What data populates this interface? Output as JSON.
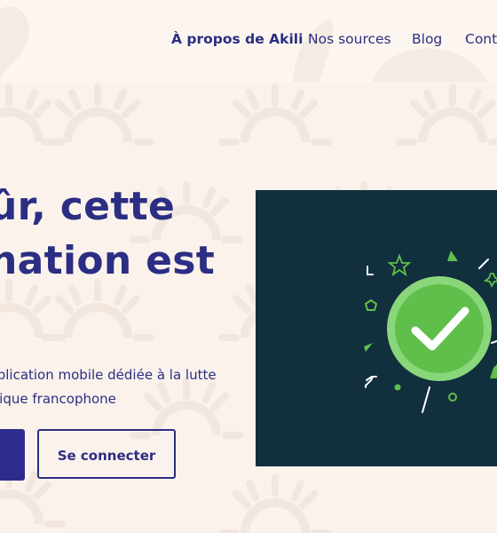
{
  "nav": {
    "items": [
      {
        "label": "À propos de Akili"
      },
      {
        "label": "Nos sources"
      },
      {
        "label": "Blog"
      },
      {
        "label": "Cont"
      }
    ]
  },
  "hero": {
    "title_lines": [
      "ûr, cette",
      "nation est"
    ],
    "subtitle_lines": [
      "application mobile dédiée à la lutte",
      "Afrique francophone"
    ],
    "primary_button_label": "",
    "secondary_button_label": "Se connecter"
  },
  "illustration": {
    "icon": "check-badge-icon",
    "background_color": "#122f3e",
    "accent_color": "#5fbf4a"
  },
  "colors": {
    "brand": "#2b2e83",
    "page_background": "#fbf2ec"
  }
}
